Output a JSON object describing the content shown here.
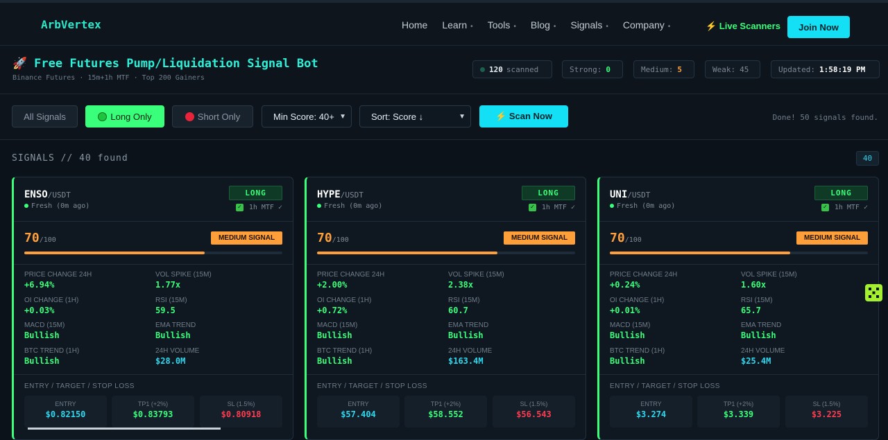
{
  "nav": {
    "logo": "ArbVertex",
    "links": [
      {
        "label": "Home",
        "dropdown": false
      },
      {
        "label": "Learn",
        "dropdown": true
      },
      {
        "label": "Tools",
        "dropdown": true
      },
      {
        "label": "Blog",
        "dropdown": true
      },
      {
        "label": "Signals",
        "dropdown": true
      },
      {
        "label": "Company",
        "dropdown": true
      }
    ],
    "dropdown_marker": "•",
    "live_scanners": "⚡ Live Scanners",
    "join": "Join Now"
  },
  "header": {
    "icon": "🚀",
    "title": "Free Futures Pump/Liquidation Signal Bot",
    "subtitle": "Binance Futures · 15m+1h MTF · Top 200 Gainers",
    "stats": {
      "scanned_value": "120",
      "scanned_label": "scanned",
      "strong_label": "Strong:",
      "strong_value": "0",
      "medium_label": "Medium:",
      "medium_value": "5",
      "weak_label": "Weak:",
      "weak_value": "45",
      "updated_label": "Updated:",
      "updated_value": "1:58:19 PM"
    }
  },
  "filters": {
    "all": "All Signals",
    "long": "Long Only",
    "short": "Short Only",
    "min_score": "Min Score: 40+",
    "sort": "Sort: Score ↓",
    "scan": "⚡ Scan Now",
    "status": "Done! 50 signals found."
  },
  "signals": {
    "header": "SIGNALS // 40 found",
    "count": "40",
    "cards": [
      {
        "symbol": "ENSO",
        "quote": "/USDT",
        "fresh": "Fresh (0m ago)",
        "direction": "LONG",
        "mtf": "1h MTF ✓",
        "score": "70",
        "score_max": "/100",
        "score_pct": 70,
        "strength": "MEDIUM SIGNAL",
        "metrics": [
          {
            "label": "PRICE CHANGE 24H",
            "value": "+6.94%"
          },
          {
            "label": "VOL SPIKE (15M)",
            "value": "1.77x"
          },
          {
            "label": "OI CHANGE (1H)",
            "value": "+0.03%"
          },
          {
            "label": "RSI (15M)",
            "value": "59.5"
          },
          {
            "label": "MACD (15M)",
            "value": "Bullish"
          },
          {
            "label": "EMA TREND",
            "value": "Bullish"
          },
          {
            "label": "BTC TREND (1H)",
            "value": "Bullish"
          },
          {
            "label": "24H VOLUME",
            "value": "$28.0M"
          }
        ],
        "entry_label": "ENTRY / TARGET / STOP LOSS",
        "entry": {
          "label": "ENTRY",
          "value": "$0.82150"
        },
        "tp": {
          "label": "TP1 (+2%)",
          "value": "$0.83793"
        },
        "sl": {
          "label": "SL (1.5%)",
          "value": "$0.80918"
        }
      },
      {
        "symbol": "HYPE",
        "quote": "/USDT",
        "fresh": "Fresh (0m ago)",
        "direction": "LONG",
        "mtf": "1h MTF ✓",
        "score": "70",
        "score_max": "/100",
        "score_pct": 70,
        "strength": "MEDIUM SIGNAL",
        "metrics": [
          {
            "label": "PRICE CHANGE 24H",
            "value": "+2.00%"
          },
          {
            "label": "VOL SPIKE (15M)",
            "value": "2.38x"
          },
          {
            "label": "OI CHANGE (1H)",
            "value": "+0.72%"
          },
          {
            "label": "RSI (15M)",
            "value": "60.7"
          },
          {
            "label": "MACD (15M)",
            "value": "Bullish"
          },
          {
            "label": "EMA TREND",
            "value": "Bullish"
          },
          {
            "label": "BTC TREND (1H)",
            "value": "Bullish"
          },
          {
            "label": "24H VOLUME",
            "value": "$163.4M"
          }
        ],
        "entry_label": "ENTRY / TARGET / STOP LOSS",
        "entry": {
          "label": "ENTRY",
          "value": "$57.404"
        },
        "tp": {
          "label": "TP1 (+2%)",
          "value": "$58.552"
        },
        "sl": {
          "label": "SL (1.5%)",
          "value": "$56.543"
        }
      },
      {
        "symbol": "UNI",
        "quote": "/USDT",
        "fresh": "Fresh (0m ago)",
        "direction": "LONG",
        "mtf": "1h MTF ✓",
        "score": "70",
        "score_max": "/100",
        "score_pct": 70,
        "strength": "MEDIUM SIGNAL",
        "metrics": [
          {
            "label": "PRICE CHANGE 24H",
            "value": "+0.24%"
          },
          {
            "label": "VOL SPIKE (15M)",
            "value": "1.60x"
          },
          {
            "label": "OI CHANGE (1H)",
            "value": "+0.01%"
          },
          {
            "label": "RSI (15M)",
            "value": "65.7"
          },
          {
            "label": "MACD (15M)",
            "value": "Bullish"
          },
          {
            "label": "EMA TREND",
            "value": "Bullish"
          },
          {
            "label": "BTC TREND (1H)",
            "value": "Bullish"
          },
          {
            "label": "24H VOLUME",
            "value": "$25.4M"
          }
        ],
        "entry_label": "ENTRY / TARGET / STOP LOSS",
        "entry": {
          "label": "ENTRY",
          "value": "$3.274"
        },
        "tp": {
          "label": "TP1 (+2%)",
          "value": "$3.339"
        },
        "sl": {
          "label": "SL (1.5%)",
          "value": "$3.225"
        }
      }
    ]
  },
  "colors": {
    "accent_cyan": "#14e0f5",
    "long_green": "#39ff7a",
    "short_red": "#ff3b4f",
    "medium_orange": "#ff9f3a"
  }
}
